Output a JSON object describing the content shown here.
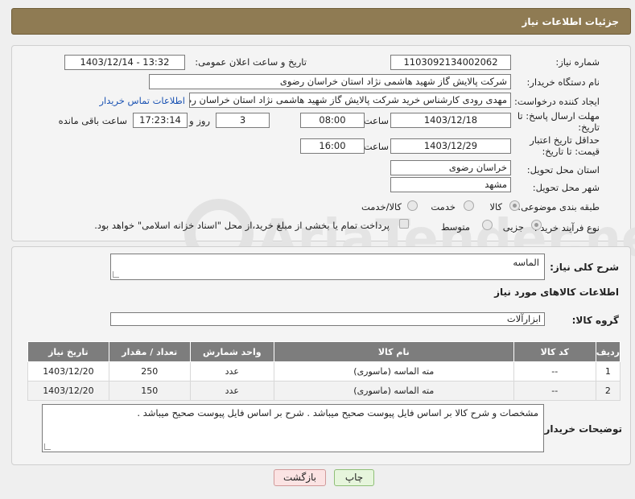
{
  "header": {
    "title": "جزئیات اطلاعات نیاز"
  },
  "form": {
    "need_number_label": "شماره نیاز:",
    "need_number": "1103092134002062",
    "announce_label": "تاریخ و ساعت اعلان عمومی:",
    "announce_value": "1403/12/14 - 13:32",
    "buyer_org_label": "نام دستگاه خریدار:",
    "buyer_org": "شرکت پالایش گاز شهید هاشمی نژاد   استان خراسان رضوی",
    "creator_label": "ایجاد کننده درخواست:",
    "creator": "مهدی رودی کارشناس خرید شرکت پالایش گاز شهید هاشمی نژاد   استان خراسان رضوی",
    "contact_link": "اطلاعات تماس خریدار",
    "deadline_label": "مهلت ارسال پاسخ: تا تاریخ:",
    "deadline_date": "1403/12/18",
    "time_label": "ساعت",
    "deadline_time": "08:00",
    "days": "3",
    "days_label": "روز و",
    "remaining": "17:23:14",
    "remaining_label": "ساعت باقی مانده",
    "validity_label": "حداقل تاریخ اعتبار قیمت: تا تاریخ:",
    "validity_date": "1403/12/29",
    "validity_time": "16:00",
    "province_label": "استان محل تحویل:",
    "province": "خراسان رضوی",
    "city_label": "شهر محل تحویل:",
    "city": "مشهد",
    "category_label": "طبقه بندی موضوعی:",
    "cat_options": [
      "کالا",
      "خدمت",
      "کالا/خدمت"
    ],
    "process_label": "نوع فرآیند خرید :",
    "process_options": [
      "جزیی",
      "متوسط"
    ],
    "payment_note": "پرداخت تمام یا بخشی از مبلغ خرید،از محل \"اسناد خزانه اسلامی\" خواهد بود."
  },
  "details": {
    "summary_label": "شرح کلی نیاز:",
    "summary": "الماسه",
    "goods_info_title": "اطلاعات کالاهای مورد نیاز",
    "group_label": "گروه کالا:",
    "group": "ابزارآلات",
    "columns": [
      "ردیف",
      "کد کالا",
      "نام کالا",
      "واحد شمارش",
      "تعداد / مقدار",
      "تاریخ نیاز"
    ],
    "rows": [
      [
        "1",
        "--",
        "مته الماسه (ماسوری)",
        "عدد",
        "250",
        "1403/12/20"
      ],
      [
        "2",
        "--",
        "مته الماسه (ماسوری)",
        "عدد",
        "150",
        "1403/12/20"
      ]
    ],
    "buyer_notes_label": "توضیحات خریدار:",
    "buyer_notes": "مشخصات و شرح کالا بر اساس فایل پیوست صحیح میباشد .  شرح بر اساس فایل پیوست صحیح میباشد ."
  },
  "buttons": {
    "print": "چاپ",
    "back": "بازگشت"
  },
  "watermark": {
    "text": "AriaTender.net"
  }
}
